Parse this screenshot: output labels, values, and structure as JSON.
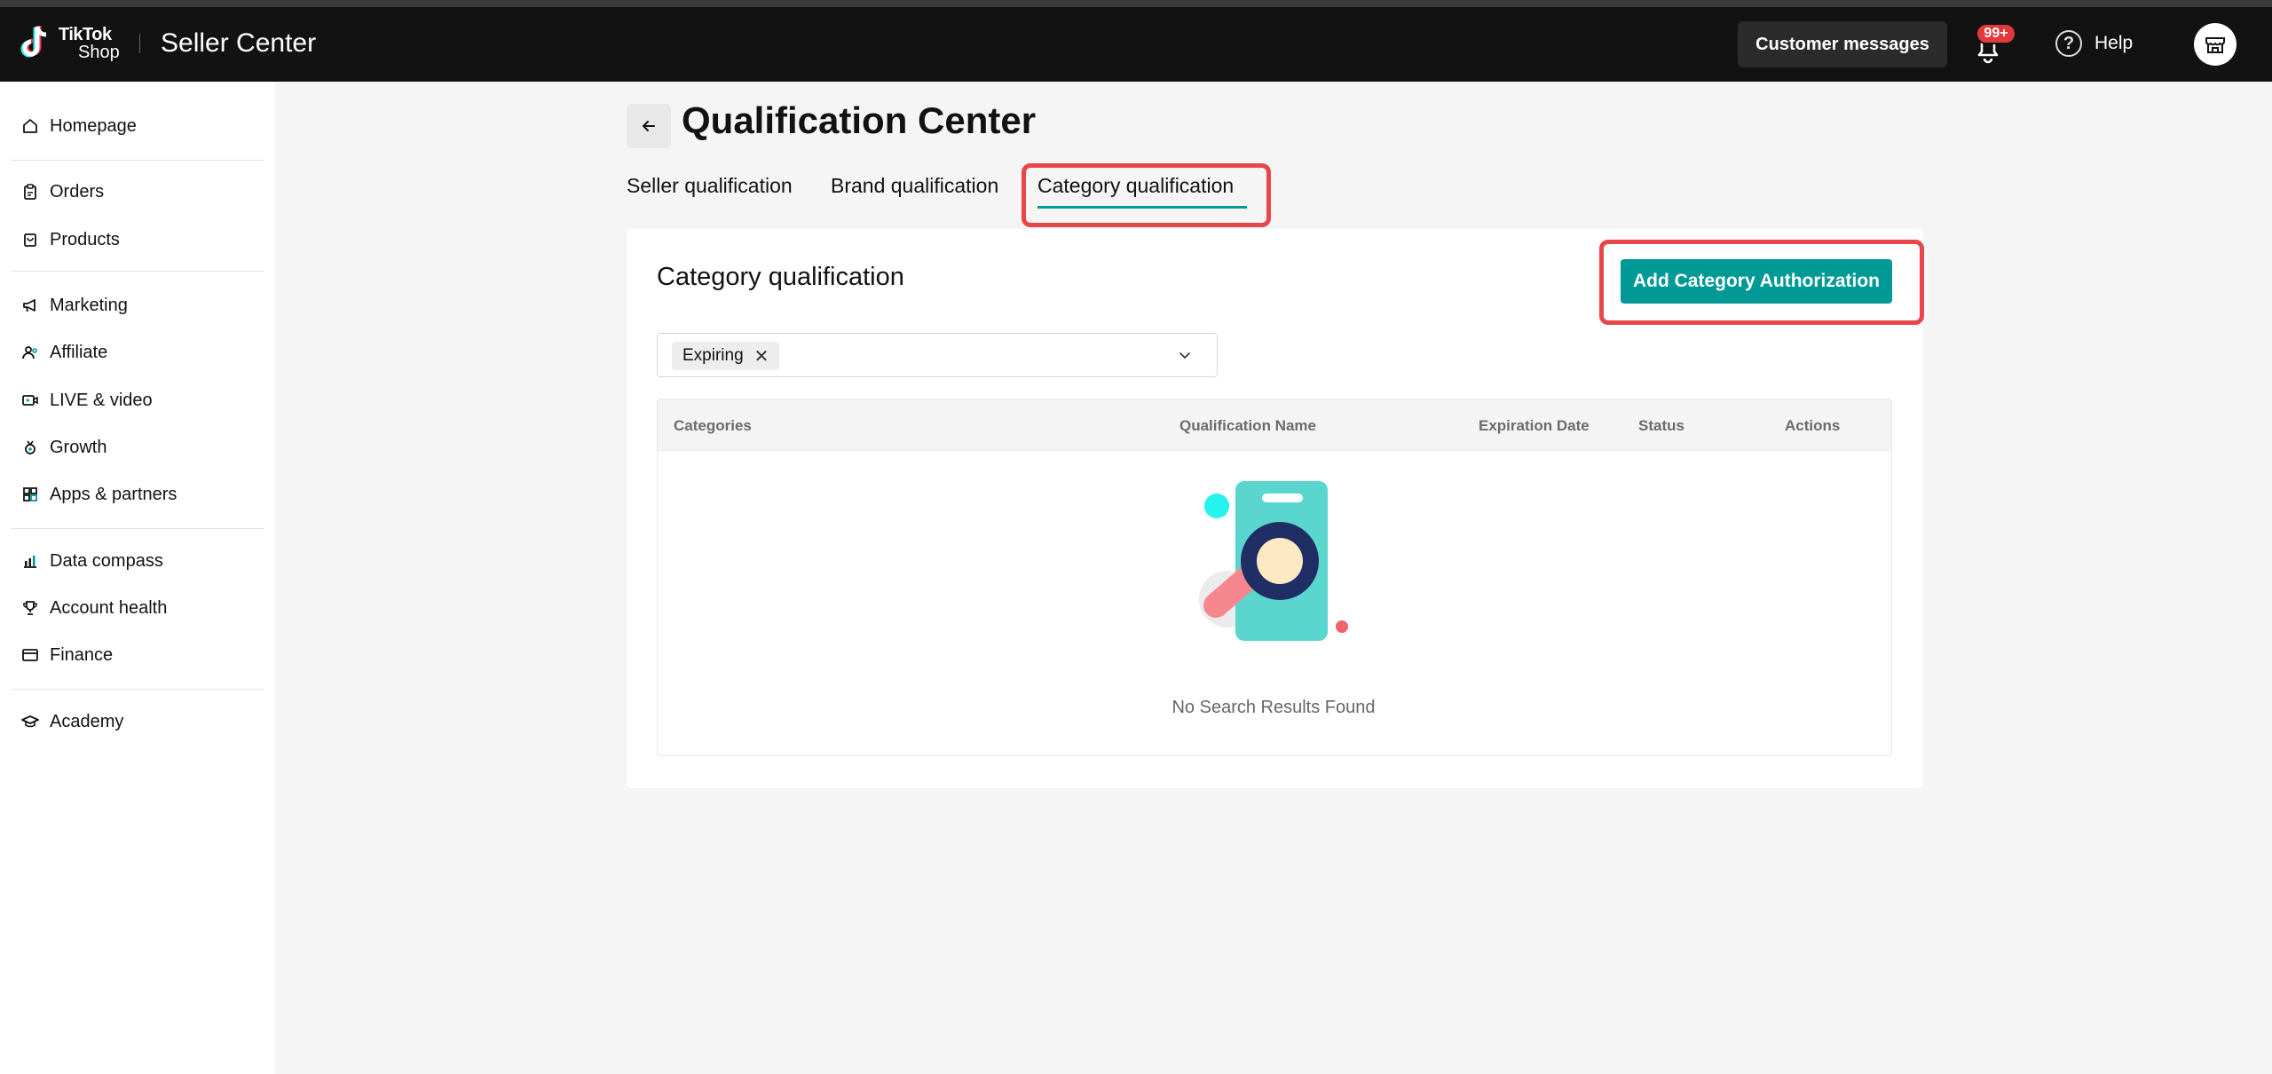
{
  "header": {
    "logo_line1": "TikTok",
    "logo_line2": "Shop",
    "app_title": "Seller Center",
    "customer_messages_label": "Customer messages",
    "notification_badge": "99+",
    "help_label": "Help"
  },
  "sidebar": {
    "items": [
      {
        "label": "Homepage",
        "icon": "home-icon"
      },
      {
        "label": "Orders",
        "icon": "clipboard-icon"
      },
      {
        "label": "Products",
        "icon": "bag-icon"
      },
      {
        "label": "Marketing",
        "icon": "megaphone-icon"
      },
      {
        "label": "Affiliate",
        "icon": "people-icon"
      },
      {
        "label": "LIVE & video",
        "icon": "video-icon"
      },
      {
        "label": "Growth",
        "icon": "medal-icon"
      },
      {
        "label": "Apps & partners",
        "icon": "apps-icon"
      },
      {
        "label": "Data compass",
        "icon": "chart-icon"
      },
      {
        "label": "Account health",
        "icon": "trophy-icon"
      },
      {
        "label": "Finance",
        "icon": "card-icon"
      },
      {
        "label": "Academy",
        "icon": "graduation-icon"
      }
    ]
  },
  "page": {
    "title": "Qualification Center",
    "tabs": [
      {
        "label": "Seller qualification",
        "active": false
      },
      {
        "label": "Brand qualification",
        "active": false
      },
      {
        "label": "Category qualification",
        "active": true
      }
    ]
  },
  "card": {
    "title": "Category qualification",
    "add_button_label": "Add Category Authorization",
    "filter": {
      "selected_chip": "Expiring"
    },
    "table": {
      "columns": [
        "Categories",
        "Qualification Name",
        "Expiration Date",
        "Status",
        "Actions"
      ],
      "rows": [],
      "empty_text": "No Search Results Found"
    }
  },
  "colors": {
    "accent": "#009995",
    "highlight": "#e8474a",
    "header_bg": "#121212",
    "badge": "#e4393c"
  }
}
